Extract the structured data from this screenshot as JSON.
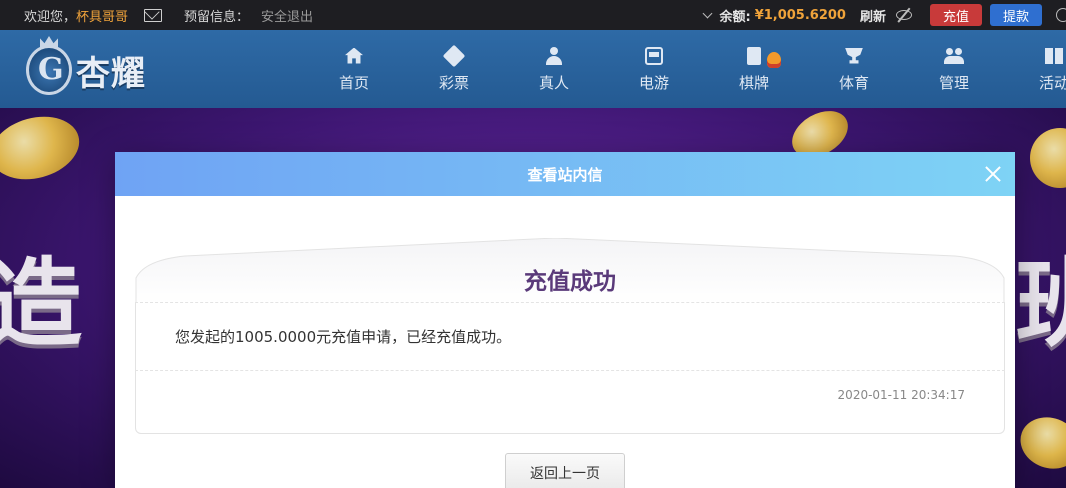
{
  "topbar": {
    "welcome": "欢迎您，",
    "username": "杯具哥哥",
    "reserve_label": "预留信息：",
    "logout": "安全退出",
    "balance_label": "余额:",
    "balance_value": "¥1,005.6200",
    "refresh": "刷新",
    "charge_button": "充值",
    "withdraw_button": "提款"
  },
  "logo": {
    "brand": "杏耀"
  },
  "nav": {
    "items": [
      {
        "label": "首页",
        "icon": "home-icon"
      },
      {
        "label": "彩票",
        "icon": "ticket-icon"
      },
      {
        "label": "真人",
        "icon": "person-icon"
      },
      {
        "label": "电游",
        "icon": "slot-machine-icon"
      },
      {
        "label": "棋牌",
        "icon": "card-icon"
      },
      {
        "label": "体育",
        "icon": "trophy-icon"
      },
      {
        "label": "管理",
        "icon": "users-icon"
      },
      {
        "label": "活动",
        "icon": "gift-icon"
      }
    ]
  },
  "banner": {
    "left_text": "造",
    "right_text": "班"
  },
  "modal": {
    "title": "查看站内信",
    "message_title": "充值成功",
    "message_body": "您发起的1005.0000元充值申请，已经充值成功。",
    "timestamp": "2020-01-11 20:34:17",
    "back_button": "返回上一页"
  },
  "colors": {
    "accent_orange": "#f0a33a",
    "charge_red": "#c83a3a",
    "withdraw_blue": "#2f6fd0",
    "nav_blue": "#2e6aa6",
    "title_purple": "#5a3a7a"
  }
}
